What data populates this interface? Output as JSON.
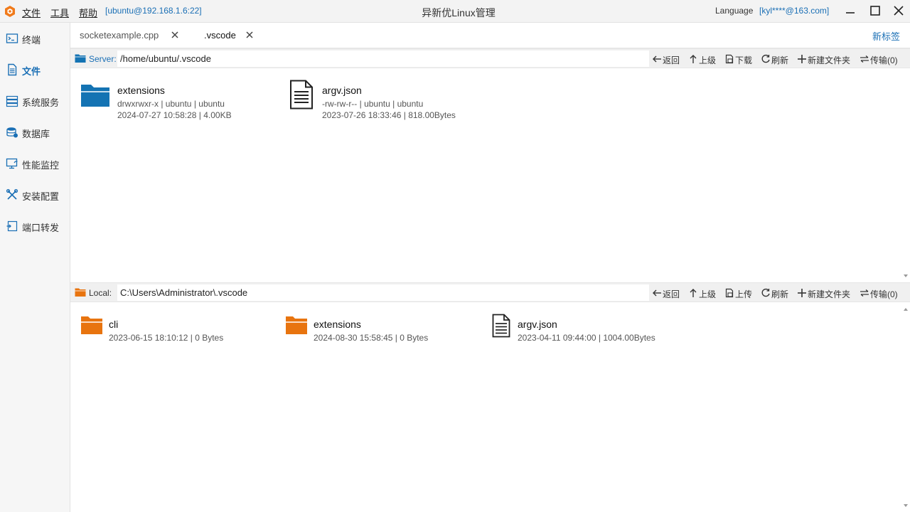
{
  "titlebar": {
    "menus": [
      "文件",
      "工具",
      "帮助"
    ],
    "connection": "[ubuntu@192.168.1.6:22]",
    "title": "异新优Linux管理",
    "language_label": "Language",
    "account": "[kyl****@163.com]"
  },
  "sidebar": {
    "items": [
      {
        "label": "终端",
        "icon": "terminal-icon"
      },
      {
        "label": "文件",
        "icon": "file-icon",
        "active": true
      },
      {
        "label": "系统服务",
        "icon": "services-icon"
      },
      {
        "label": "数据库",
        "icon": "database-icon"
      },
      {
        "label": "性能监控",
        "icon": "monitor-icon"
      },
      {
        "label": "安装配置",
        "icon": "tools-icon"
      },
      {
        "label": "端口转发",
        "icon": "port-forward-icon"
      }
    ]
  },
  "tabs": {
    "items": [
      {
        "label": "socketexample.cpp",
        "active": false
      },
      {
        "label": ".vscode",
        "active": true
      }
    ],
    "new_tab": "新标签"
  },
  "server": {
    "label": "Server:",
    "path": "/home/ubuntu/.vscode",
    "toolbar": {
      "back": "返回",
      "up": "上级",
      "download": "下载",
      "refresh": "刷新",
      "new_folder": "新建文件夹",
      "transfer": "传输(0)"
    },
    "files": [
      {
        "name": "extensions",
        "type": "folder",
        "perm": "drwxrwxr-x | ubuntu | ubuntu",
        "meta": "2024-07-27 10:58:28 | 4.00KB"
      },
      {
        "name": "argv.json",
        "type": "file",
        "perm": "-rw-rw-r-- | ubuntu | ubuntu",
        "meta": "2023-07-26 18:33:46 | 818.00Bytes"
      }
    ]
  },
  "local": {
    "label": "Local:",
    "path": "C:\\Users\\Administrator\\.vscode",
    "toolbar": {
      "back": "返回",
      "up": "上级",
      "upload": "上传",
      "refresh": "刷新",
      "new_folder": "新建文件夹",
      "transfer": "传输(0)"
    },
    "files": [
      {
        "name": "cli",
        "type": "folder",
        "meta": "2023-06-15 18:10:12 | 0 Bytes"
      },
      {
        "name": "extensions",
        "type": "folder",
        "meta": "2024-08-30 15:58:45 | 0 Bytes"
      },
      {
        "name": "argv.json",
        "type": "file",
        "meta": "2023-04-11 09:44:00 | 1004.00Bytes"
      }
    ]
  },
  "colors": {
    "accent": "#1a6fb5",
    "server_folder": "#1473b3",
    "local_folder": "#e8740f"
  }
}
